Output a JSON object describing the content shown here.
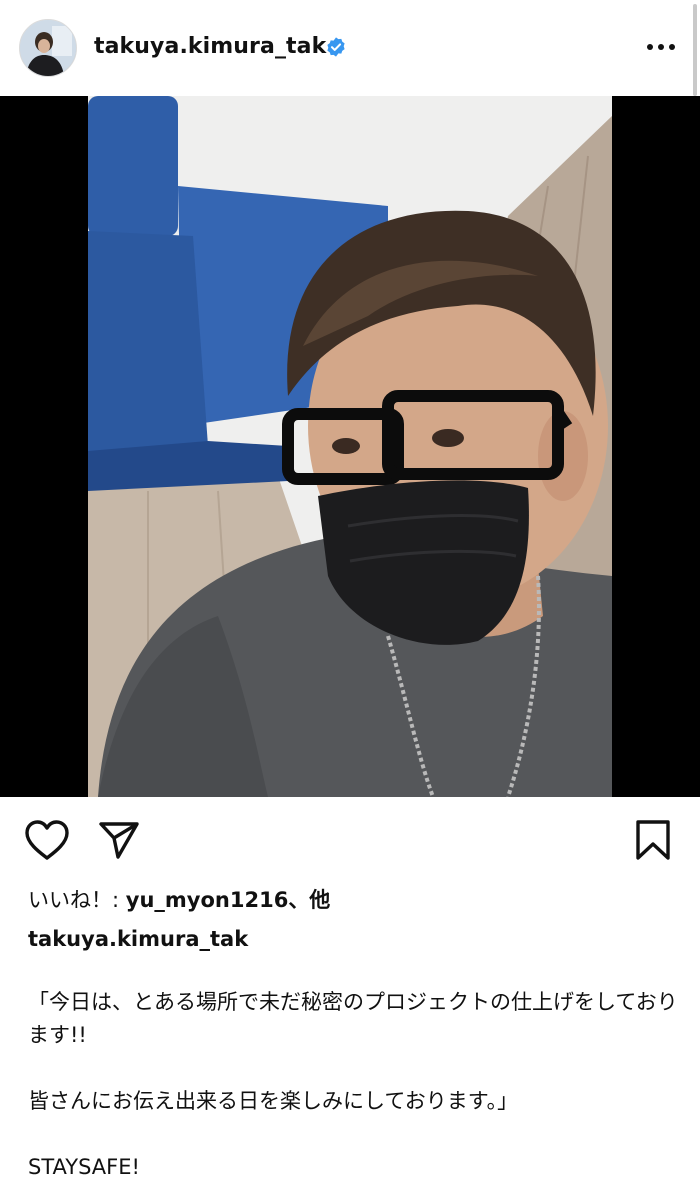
{
  "post": {
    "username": "takuya.kimura_tak",
    "verified": true,
    "more_icon": "more-horizontal-icon",
    "likes_prefix": "いいね！: ",
    "likes_user": "yu_myon1216",
    "likes_suffix": "、他",
    "caption_username": "takuya.kimura_tak",
    "caption_text": "「今日は、とある場所で未だ秘密のプロジェクトの仕上げをしております!!\n\n皆さんにお伝え出来る日を楽しみにしております。」\n\nSTAYSAFE!"
  },
  "actions": {
    "like_icon": "heart-icon",
    "share_icon": "send-icon",
    "save_icon": "bookmark-icon"
  },
  "colors": {
    "verified": "#3897f0",
    "text": "#111111",
    "media_background": "#000000"
  }
}
